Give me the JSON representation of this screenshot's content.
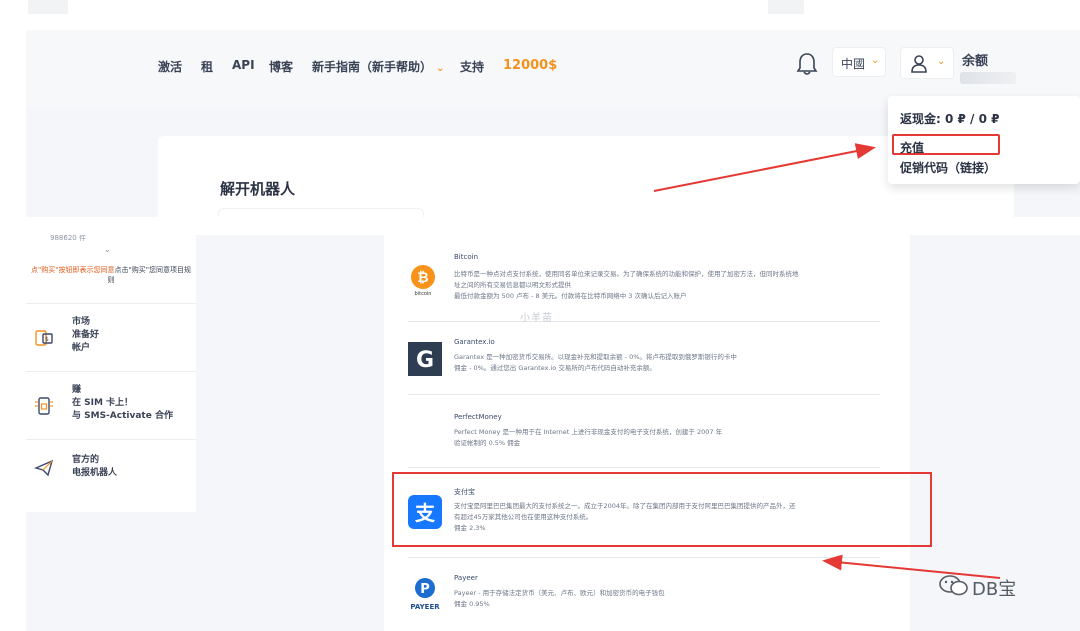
{
  "nav": {
    "items": [
      "激活",
      "租",
      "API",
      "博客",
      "新手指南（新手帮助）",
      "支持"
    ],
    "price": "12000$",
    "language": "中國",
    "balance_label": "余额"
  },
  "dropdown": {
    "cashback": "返现金: 0 ₽ / 0 ₽",
    "recharge": "充值",
    "promo": "促销代码（链接）"
  },
  "unlock": {
    "title": "解开机器人"
  },
  "sidebar": {
    "top_small": "988620 件",
    "red_text_1": "点\"购买\"按钮即表示您同意",
    "red_text_2": "点击\"购买\"您同意项目规",
    "red_text_3": "则",
    "items": [
      {
        "icon": "market-icon",
        "line1": "市场",
        "line2": "准备好",
        "line3": "帐户"
      },
      {
        "icon": "sim-card-icon",
        "line1": "赚",
        "line2": "在 SIM 卡上！",
        "line3": "与 SMS-Activate 合作"
      },
      {
        "icon": "robot-icon",
        "line1": "官方的",
        "line2": "电报机器人",
        "line3": ""
      }
    ]
  },
  "payment_methods": [
    {
      "name": "Bitcoin",
      "logo": "bitcoin-logo",
      "logo_text": "bitcoin",
      "desc1": "比特币是一种点对点支付系统，使用同名单位来记录交易。为了确保系统的功能和保护，使用了加密方法，但同时系统地",
      "desc2": "址之间的所有交易信息都以明文形式提供",
      "desc3": "最低付款金额为 500 卢布 - 8 美元。付款将在比特币网络中 3 次确认后记入账户"
    },
    {
      "name": "Garantex.io",
      "logo": "garantex-logo",
      "logo_text": "G",
      "desc1": "Garantex 是一种加密货币交易所。以现金补充和提取余额 - 0%。将卢布提取到俄罗斯银行的卡中",
      "desc2": "佣金 - 0%。通过您出 Garantex.io 交易所的卢布代码自动补充余额。",
      "desc3": ""
    },
    {
      "name": "PerfectMoney",
      "logo": "",
      "logo_text": "",
      "desc1": "Perfect Money 是一种用于在 Internet 上进行非现金支付的电子支付系统，创建于 2007 年",
      "desc2": "验证帐制的 0.5% 佣金",
      "desc3": ""
    },
    {
      "name": "支付宝",
      "logo": "alipay-logo",
      "logo_text": "支",
      "desc1": "支付宝是阿里巴巴集团最大的支付系统之一。成立于2004年。除了在集团内部用于支付阿里巴巴集团提供的产品外，还",
      "desc2": "有超过45万家其他公司也在使用这种支付系统。",
      "desc3": "佣金 2.3%"
    },
    {
      "name": "Payeer",
      "logo": "payeer-logo",
      "logo_text": "PAYEER",
      "desc1": "Payeer - 用于存储法定货币（美元、卢布、欧元）和加密货币的电子钱包",
      "desc2": "佣金 0.95%",
      "desc3": ""
    }
  ],
  "watermark": {
    "middle": "小羊苗",
    "wechat": "DB宝"
  },
  "colors": {
    "accent": "#f5921e",
    "highlight": "#e53935",
    "alipay": "#1677ff",
    "garantex": "#2e3d52"
  }
}
